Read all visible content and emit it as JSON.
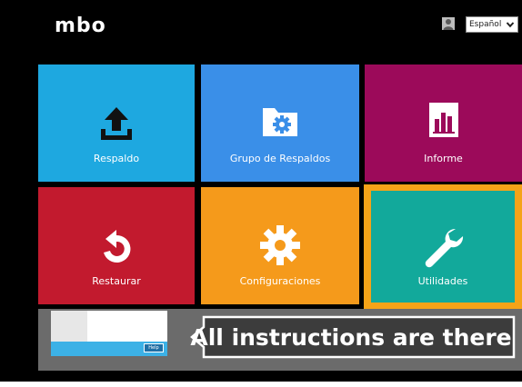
{
  "header": {
    "logo_text": "mbo",
    "language": "Español",
    "user_icon": "user-icon",
    "language_chevron_icon": "chevron-down-icon"
  },
  "tiles": [
    {
      "label": "Respaldo",
      "color": "#1ea8e0",
      "icon": "upload-icon"
    },
    {
      "label": "Grupo de Respaldos",
      "color": "#3a8fe8",
      "icon": "folder-gear-icon"
    },
    {
      "label": "Informe",
      "color": "#9c0a5a",
      "icon": "report-chart-icon"
    },
    {
      "label": "Restaurar",
      "color": "#c21a2e",
      "icon": "restore-icon"
    },
    {
      "label": "Configuraciones",
      "color": "#f59a1b",
      "icon": "gear-icon"
    },
    {
      "label": "Utilidades",
      "color": "#12a99b",
      "icon": "wrench-icon"
    }
  ],
  "selected_tile_border_color": "#f5a318",
  "banner": {
    "mini_help_label": "Help",
    "callout_text": "All instructions are there"
  }
}
